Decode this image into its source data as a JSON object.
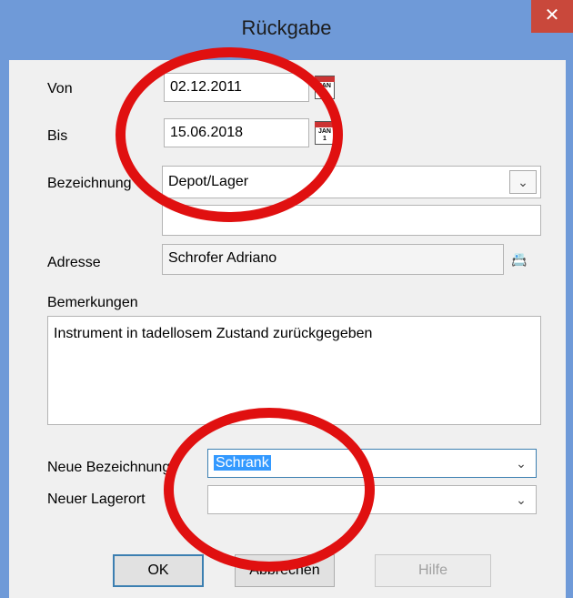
{
  "window": {
    "title": "Rückgabe",
    "close_glyph": "✕"
  },
  "form": {
    "von": {
      "label": "Von",
      "value": "02.12.2011"
    },
    "bis": {
      "label": "Bis",
      "value": "15.06.2018"
    },
    "bezeichnung": {
      "label": "Bezeichnung",
      "value": "Depot/Lager",
      "second_line": ""
    },
    "adresse": {
      "label": "Adresse",
      "value": "Schrofer Adriano"
    },
    "bemerkungen": {
      "label": "Bemerkungen",
      "value": "Instrument in tadellosem Zustand zurückgegeben"
    },
    "neue_bezeichnung": {
      "label": "Neue Bezeichnung",
      "value": "Schrank"
    },
    "neuer_lagerort": {
      "label": "Neuer Lagerort",
      "value": ""
    }
  },
  "calendar_icon": {
    "month": "JAN",
    "day": "1"
  },
  "buttons": {
    "ok": "OK",
    "cancel": "Abbrechen",
    "help": "Hilfe"
  },
  "annotations": {
    "color": "#e01010"
  }
}
